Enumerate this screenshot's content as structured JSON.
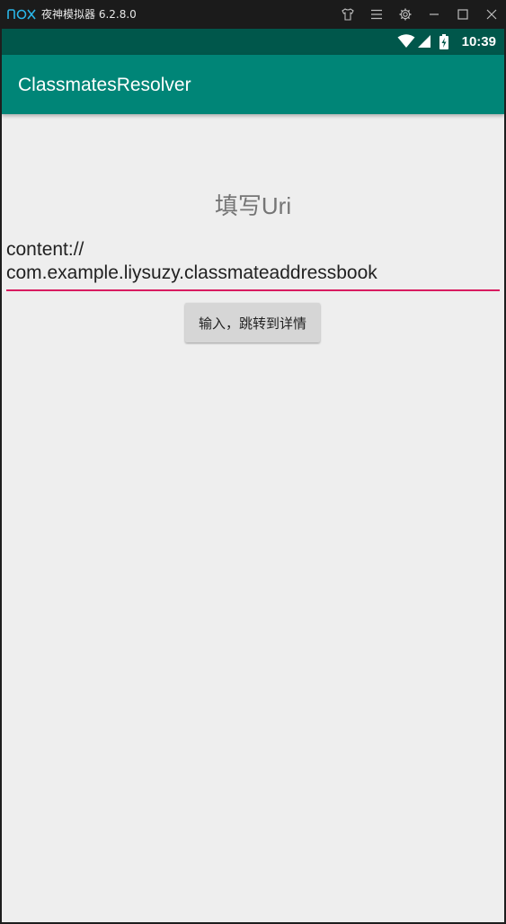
{
  "emulator": {
    "title": "夜神模拟器 6.2.8.0",
    "brand_color": "#2ab6e8",
    "controls": [
      "shirt-icon",
      "menu-icon",
      "settings-icon",
      "minimize-icon",
      "maximize-icon",
      "close-icon"
    ]
  },
  "status_bar": {
    "time": "10:39",
    "icons": [
      "wifi-icon",
      "signal-icon",
      "battery-charging-icon"
    ],
    "color": "#00574b"
  },
  "app_bar": {
    "title": "ClassmatesResolver",
    "color": "#008577"
  },
  "main": {
    "heading": "填写Uri",
    "uri_input": {
      "value": "content://\ncom.example.liysuzy.classmateaddressbook",
      "underline_color": "#d81b60"
    },
    "submit_button": {
      "label": "输入，跳转到详情"
    }
  }
}
